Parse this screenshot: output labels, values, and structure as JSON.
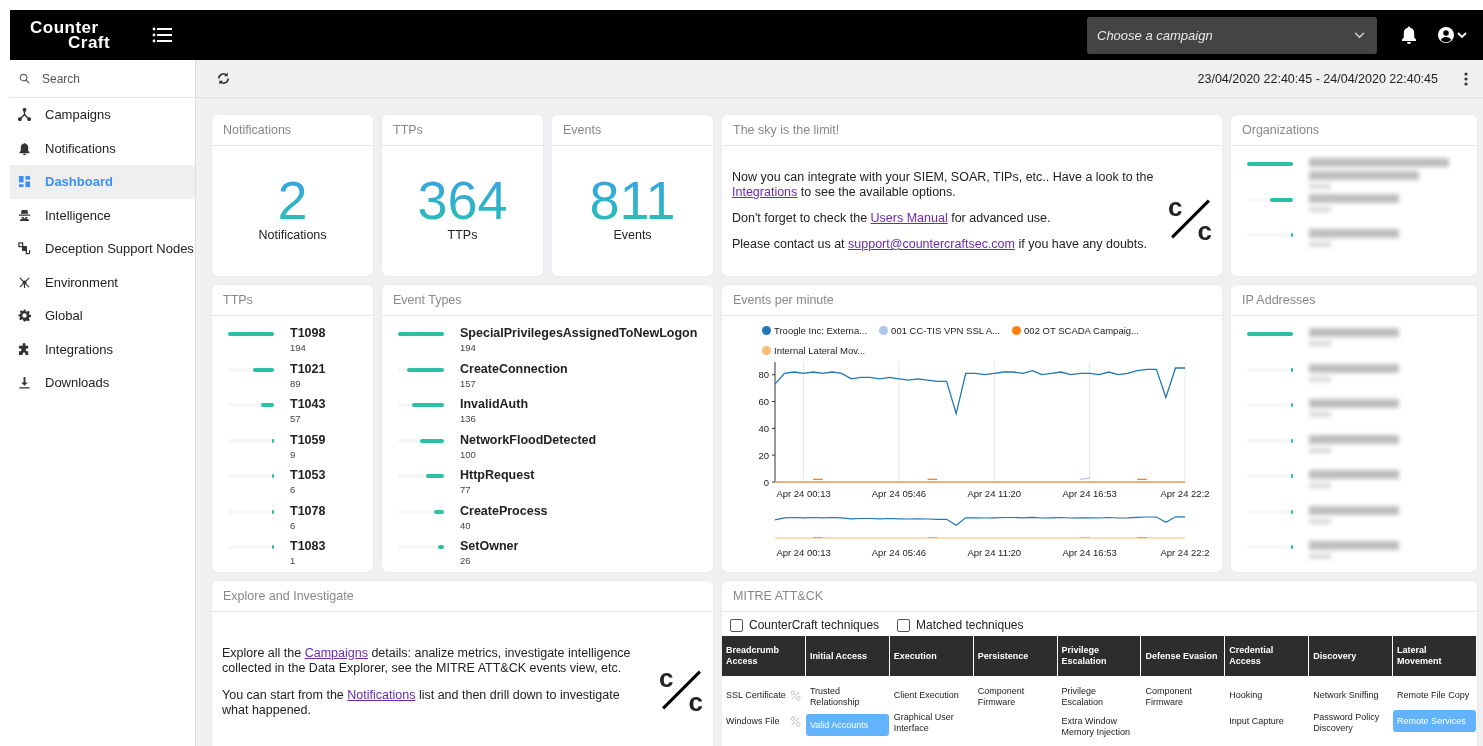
{
  "brand": {
    "top": "Counter",
    "bottom": "Craft"
  },
  "header": {
    "campaign_select": {
      "placeholder": "Choose a campaign"
    }
  },
  "sidebar": {
    "search": {
      "placeholder": "Search"
    },
    "items": [
      {
        "label": "Campaigns",
        "selected": false
      },
      {
        "label": "Notifications",
        "selected": false
      },
      {
        "label": "Dashboard",
        "selected": true
      },
      {
        "label": "Intelligence",
        "selected": false
      },
      {
        "label": "Deception Support Nodes",
        "selected": false
      },
      {
        "label": "Environment",
        "selected": false
      },
      {
        "label": "Global",
        "selected": false
      },
      {
        "label": "Integrations",
        "selected": false
      },
      {
        "label": "Downloads",
        "selected": false
      }
    ]
  },
  "toolbar": {
    "date_range": "23/04/2020 22:40:45 - 24/04/2020 22:40:45"
  },
  "stat_cards": [
    {
      "title": "Notifications",
      "value": "2",
      "caption": "Notifications"
    },
    {
      "title": "TTPs",
      "value": "364",
      "caption": "TTPs"
    },
    {
      "title": "Events",
      "value": "811",
      "caption": "Events"
    }
  ],
  "sky_card": {
    "title": "The sky is the limit!",
    "paragraphs": [
      {
        "before": "Now you can integrate with your SIEM, SOAR, TIPs, etc.. Have a look to the ",
        "link": "Integrations",
        "after": " to see the available options."
      },
      {
        "before": "Don't forget to check the ",
        "link": "Users Manual",
        "after": " for advanced use."
      },
      {
        "before": "Please contact us at ",
        "link": "support@countercraftsec.com",
        "after": " if you have any doubts."
      }
    ],
    "logo": {
      "top": "c",
      "bottom": "c"
    }
  },
  "organizations": {
    "title": "Organizations",
    "items": [
      {
        "level": 1
      },
      {
        "level": 0.5
      },
      {
        "level": 0.04
      }
    ]
  },
  "ttps": {
    "title": "TTPs",
    "items": [
      {
        "name": "T1098",
        "count": "194",
        "level": 1
      },
      {
        "name": "T1021",
        "count": "89",
        "level": 0.46
      },
      {
        "name": "T1043",
        "count": "57",
        "level": 0.29
      },
      {
        "name": "T1059",
        "count": "9",
        "level": 0.05
      },
      {
        "name": "T1053",
        "count": "6",
        "level": 0.03
      },
      {
        "name": "T1078",
        "count": "6",
        "level": 0.03
      },
      {
        "name": "T1083",
        "count": "1",
        "level": 0.01
      }
    ]
  },
  "event_types": {
    "title": "Event Types",
    "items": [
      {
        "name": "SpecialPrivilegesAssignedToNewLogon",
        "count": "194",
        "level": 1
      },
      {
        "name": "CreateConnection",
        "count": "157",
        "level": 0.81
      },
      {
        "name": "InvalidAuth",
        "count": "136",
        "level": 0.7
      },
      {
        "name": "NetworkFloodDetected",
        "count": "100",
        "level": 0.52
      },
      {
        "name": "HttpRequest",
        "count": "77",
        "level": 0.4
      },
      {
        "name": "CreateProcess",
        "count": "40",
        "level": 0.21
      },
      {
        "name": "SetOwner",
        "count": "26",
        "level": 0.13
      }
    ]
  },
  "events_per_minute": {
    "title": "Events per minute",
    "chart_data": {
      "type": "line",
      "legend": "top",
      "grid": true,
      "categories": [
        null,
        null,
        null,
        "Apr 24 00:13",
        null,
        null,
        null,
        null,
        null,
        null,
        null,
        null,
        null,
        "Apr 24 05:46",
        null,
        null,
        null,
        null,
        null,
        null,
        null,
        null,
        null,
        "Apr 24 11:20",
        null,
        null,
        null,
        null,
        null,
        null,
        null,
        null,
        null,
        "Apr 24 16:53",
        null,
        null,
        null,
        null,
        null,
        null,
        null,
        null,
        null,
        "Apr 24 22:2"
      ],
      "ylim": [
        0,
        88
      ],
      "yticks": [
        0,
        20,
        40,
        60,
        80
      ],
      "series": [
        {
          "name": "Troogle Inc: Externa...",
          "color": "#1f77b4",
          "values": [
            73,
            81,
            82,
            81,
            82,
            81,
            82,
            81,
            77,
            78,
            78,
            77,
            78,
            77,
            76,
            77,
            76,
            75,
            75,
            51,
            81,
            81,
            80,
            81,
            82,
            82,
            81,
            83,
            80,
            81,
            82,
            80,
            81,
            81,
            80,
            82,
            80,
            81,
            83,
            84,
            84,
            63,
            85,
            85
          ]
        },
        {
          "name": "001 CC-TIS VPN SSL A...",
          "color": "#aec7e8",
          "values": [
            null,
            null,
            null,
            null,
            null,
            null,
            null,
            null,
            null,
            null,
            null,
            null,
            null,
            null,
            null,
            null,
            null,
            null,
            null,
            null,
            null,
            null,
            null,
            null,
            null,
            null,
            null,
            null,
            null,
            null,
            null,
            null,
            2,
            3,
            null,
            null,
            null,
            null,
            null,
            null,
            null,
            null,
            null,
            null
          ]
        },
        {
          "name": "002 OT SCADA Campaig...",
          "color": "#ff7f0e",
          "values": [
            null,
            null,
            null,
            null,
            2,
            2,
            null,
            null,
            null,
            null,
            null,
            null,
            null,
            null,
            null,
            null,
            2,
            2,
            null,
            null,
            null,
            null,
            null,
            null,
            null,
            null,
            null,
            null,
            null,
            null,
            null,
            null,
            null,
            null,
            null,
            null,
            null,
            null,
            2,
            2,
            null,
            null,
            null,
            null
          ]
        },
        {
          "name": "Internal Lateral Mov...",
          "color": "#ffbb78",
          "values": [
            0,
            0,
            0,
            0,
            0,
            0,
            0,
            0,
            0,
            0,
            0,
            0,
            0,
            0,
            0,
            0,
            0,
            0,
            0,
            0,
            0,
            0,
            0,
            0,
            0,
            0,
            0,
            0,
            0,
            0,
            0,
            0,
            0,
            0,
            0,
            0,
            0,
            0,
            0,
            0,
            0,
            0,
            0,
            0
          ]
        }
      ]
    }
  },
  "ip_addresses": {
    "title": "IP Addresses",
    "items": [
      {
        "level": 1
      },
      {
        "level": 0.04
      },
      {
        "level": 0.02
      },
      {
        "level": 0.02
      },
      {
        "level": 0.01
      },
      {
        "level": 0.01
      },
      {
        "level": 0.01
      }
    ]
  },
  "explore_card": {
    "title": "Explore and Investigate",
    "paragraphs": [
      {
        "before": "Explore all the ",
        "link": "Campaigns",
        "after": " details: analize metrics, investigate intelligence collected in the Data Explorer, see the MITRE ATT&CK events view, etc."
      },
      {
        "before": "You can start from the ",
        "link": "Notifications",
        "after": " list and then drill down to investigate what happened."
      }
    ],
    "logo": {
      "top": "c",
      "bottom": "c"
    }
  },
  "mitre": {
    "title": "MITRE ATT&CK",
    "filters": [
      {
        "label": "CounterCraft techniques",
        "checked": false
      },
      {
        "label": "Matched techniques",
        "checked": false
      }
    ],
    "columns": [
      {
        "header": "Breadcrumb Access",
        "cells": [
          {
            "text": "SSL Certificate",
            "selected": false,
            "percent_icon": true
          },
          {
            "text": "Windows File",
            "selected": false,
            "percent_icon": true
          }
        ]
      },
      {
        "header": "Initial Access",
        "cells": [
          {
            "text": "Trusted Relationship",
            "selected": false,
            "percent_icon": false
          },
          {
            "text": "Valid Accounts",
            "selected": true,
            "percent_icon": false
          }
        ]
      },
      {
        "header": "Execution",
        "cells": [
          {
            "text": "Client Execution",
            "selected": false,
            "percent_icon": false
          },
          {
            "text": "Graphical User Interface",
            "selected": false,
            "percent_icon": false
          }
        ]
      },
      {
        "header": "Persistence",
        "cells": [
          {
            "text": "Component Firmware",
            "selected": false,
            "percent_icon": false
          }
        ]
      },
      {
        "header": "Privilege Escalation",
        "cells": [
          {
            "text": "Privilege Escalation",
            "selected": false,
            "percent_icon": false
          },
          {
            "text": "Extra Window Memory Injection",
            "selected": false,
            "percent_icon": false
          }
        ]
      },
      {
        "header": "Defense Evasion",
        "cells": [
          {
            "text": "Component Firmware",
            "selected": false,
            "percent_icon": false
          }
        ]
      },
      {
        "header": "Credential Access",
        "cells": [
          {
            "text": "Hooking",
            "selected": false,
            "percent_icon": false
          },
          {
            "text": "Input Capture",
            "selected": false,
            "percent_icon": false
          }
        ]
      },
      {
        "header": "Discovery",
        "cells": [
          {
            "text": "Network Sniffing",
            "selected": false,
            "percent_icon": false
          },
          {
            "text": "Password Policy Discovery",
            "selected": false,
            "percent_icon": false
          }
        ]
      },
      {
        "header": "Lateral Movement",
        "cells": [
          {
            "text": "Remote File Copy",
            "selected": false,
            "percent_icon": false
          },
          {
            "text": "Remote Services",
            "selected": true,
            "percent_icon": false
          }
        ]
      }
    ]
  }
}
